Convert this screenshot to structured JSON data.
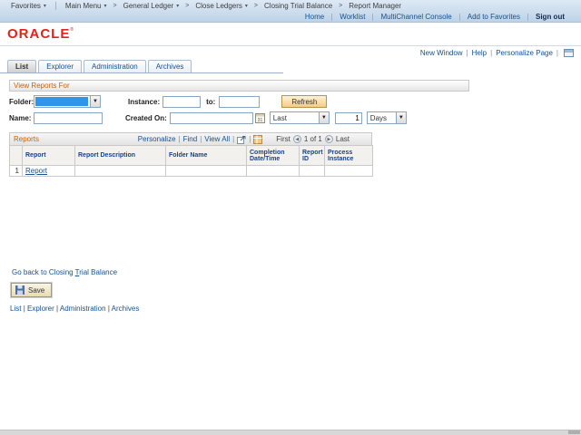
{
  "topbar": {
    "favorites_label": "Favorites",
    "crumbs": [
      "Main Menu",
      "General Ledger",
      "Close Ledgers",
      "Closing Trial Balance",
      "Report Manager"
    ],
    "links": [
      "Home",
      "Worklist",
      "MultiChannel Console",
      "Add to Favorites"
    ],
    "signout_label": "Sign out"
  },
  "brand": {
    "logo_text": "ORACLE",
    "logo_mark": "®"
  },
  "utility": {
    "new_window": "New Window",
    "help": "Help",
    "personalize_page": "Personalize Page"
  },
  "tabs": {
    "list": "List",
    "explorer": "Explorer",
    "administration": "Administration",
    "archives": "Archives"
  },
  "filters": {
    "title": "View Reports For",
    "folder_label": "Folder:",
    "folder_value": "",
    "instance_label": "Instance:",
    "instance_value": "",
    "to_label": "to:",
    "to_value": "",
    "refresh_label": "Refresh",
    "name_label": "Name:",
    "name_value": "",
    "created_on_label": "Created On:",
    "created_on_value": "",
    "last_value": "Last",
    "days_count_value": "1",
    "days_unit_value": "Days"
  },
  "grid": {
    "title": "Reports",
    "personalize": "Personalize",
    "find": "Find",
    "view_all": "View All",
    "pager_first": "First",
    "pager_status": "1 of 1",
    "pager_last": "Last",
    "columns": [
      "Report",
      "Report Description",
      "Folder Name",
      "Completion Date/Time",
      "Report ID",
      "Process Instance"
    ],
    "rows": [
      {
        "num": "1",
        "report": "Report",
        "description": "",
        "folder": "",
        "completion": "",
        "report_id": "",
        "process_instance": ""
      }
    ]
  },
  "footer": {
    "go_back_pre": "Go back to Closing ",
    "go_back_key": "T",
    "go_back_post": "rial Balance",
    "save_label": "Save",
    "links": [
      "List",
      "Explorer",
      "Administration",
      "Archives"
    ]
  },
  "colors": {
    "accent_orange": "#c96006",
    "link_blue": "#15518f",
    "oracle_red": "#e2231a",
    "selection_blue": "#2e95e8"
  }
}
